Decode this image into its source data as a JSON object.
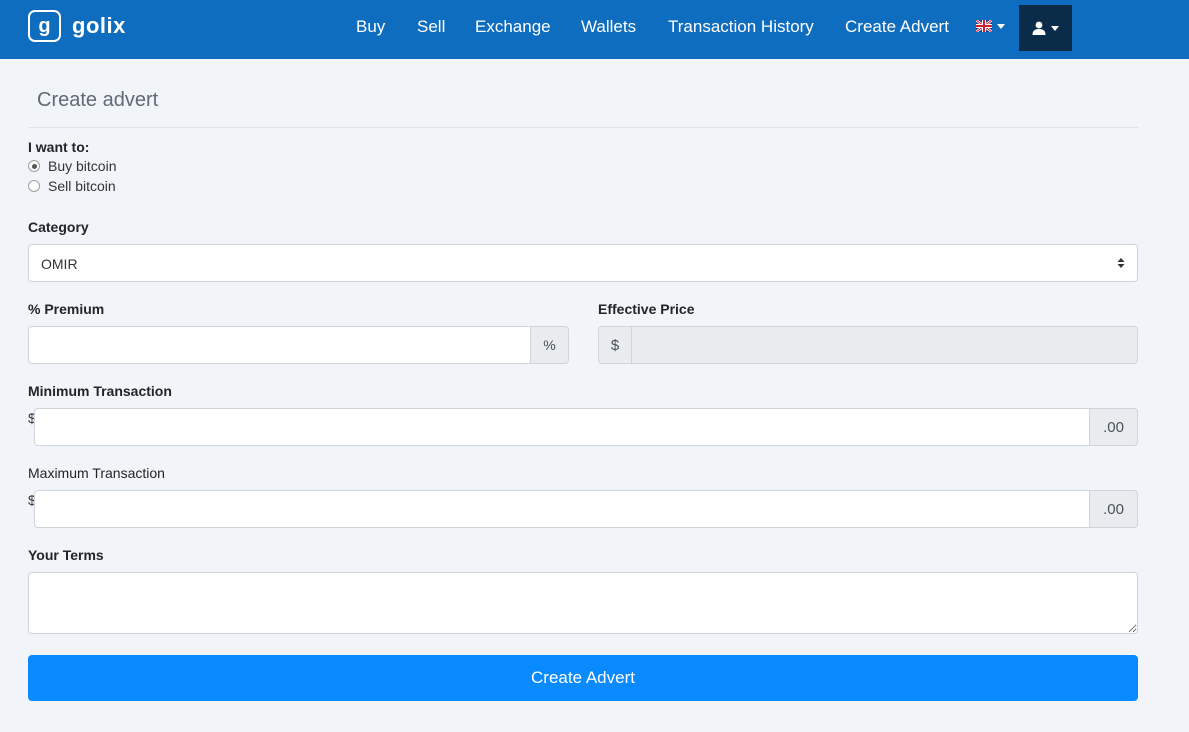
{
  "brand": {
    "mark": "g",
    "name": "golix"
  },
  "nav": {
    "items": [
      {
        "label": "Buy"
      },
      {
        "label": "Sell"
      },
      {
        "label": "Exchange"
      },
      {
        "label": "Wallets"
      },
      {
        "label": "Transaction History"
      },
      {
        "label": "Create Advert"
      }
    ],
    "language_icon": "uk-flag-icon",
    "user_icon": "user-icon"
  },
  "form": {
    "title": "Create advert",
    "want_label": "I want to:",
    "options": [
      {
        "label": "Buy bitcoin",
        "checked": true
      },
      {
        "label": "Sell bitcoin",
        "checked": false
      }
    ],
    "category": {
      "label": "Category",
      "value": "OMIR"
    },
    "premium": {
      "label": "% Premium",
      "value": "",
      "suffix": "%"
    },
    "effective_price": {
      "label": "Effective Price",
      "prefix": "$",
      "value": ""
    },
    "min_transaction": {
      "label": "Minimum Transaction",
      "prefix": "$",
      "value": "",
      "suffix": ".00"
    },
    "max_transaction": {
      "label": "Maximum Transaction",
      "prefix": "$",
      "value": "",
      "suffix": ".00"
    },
    "terms": {
      "label": "Your Terms",
      "value": ""
    },
    "submit_label": "Create Advert"
  },
  "colors": {
    "navbar": "#0f6dbf",
    "user_toggle": "#0b2c48",
    "submit": "#0a8aff",
    "background": "#f1f5f9"
  }
}
